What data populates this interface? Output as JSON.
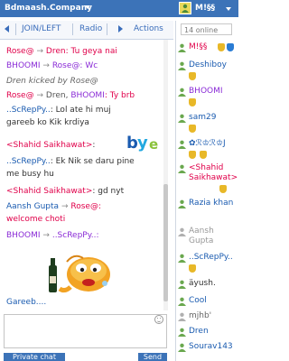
{
  "topbar": {
    "app_title": "Bdmaash.Company",
    "user_name": "M!§§"
  },
  "tabs": {
    "join_left": "JOIN/LEFT",
    "radio": "Radio",
    "actions": "Actions"
  },
  "sidebar": {
    "online": "14 online",
    "users": [
      {
        "name": "M!§§",
        "color": "#e0004a"
      },
      {
        "name": "Deshiboy",
        "color": "#1a5bb0"
      },
      {
        "name": "BHOOMI",
        "color": "#8a2bd6"
      },
      {
        "name": "sam29",
        "color": "#1a5bb0"
      },
      {
        "name": "✿ℛ♔ℛ♔J",
        "color": "#1a5bb0"
      },
      {
        "name": "<Shahid Saikhawat>",
        "color": "#e0004a"
      },
      {
        "name": "Razia khan",
        "color": "#1a5bb0"
      },
      {
        "name": "Aansh Gupta",
        "color": "#999999"
      },
      {
        "name": "..ScRepPy..",
        "color": "#1a5bb0"
      },
      {
        "name": "äyush.",
        "color": "#333333"
      },
      {
        "name": "Cool",
        "color": "#1a5bb0"
      },
      {
        "name": "mjhb'",
        "color": "#666666"
      },
      {
        "name": "Dren",
        "color": "#1a5bb0"
      },
      {
        "name": "Sourav143",
        "color": "#1a5bb0"
      }
    ]
  },
  "messages": {
    "m1": {
      "from": "Rose@",
      "to": "Dren",
      "text": ": Tu geya nai"
    },
    "m2": {
      "from": "BHOOMI",
      "to": "Rose@",
      "text": ": Wc"
    },
    "m3": {
      "text": "Dren kicked by Rose@"
    },
    "m4": {
      "from": "Rose@",
      "to": "Dren,",
      "to2": "BHOOMI",
      "text": ": Ty brb"
    },
    "m5": {
      "from": "..ScRepPy..",
      "text": ": Lol ate hi muj",
      "text2": "gareeb ko Kik krdiya"
    },
    "m6": {
      "from": "<Shahid Saikhawat>",
      "text": ":"
    },
    "m7": {
      "from": "..ScRepPy..",
      "text": ": Ek Nik se daru pine",
      "text2": "me busy hu"
    },
    "m8": {
      "from": "<Shahid Saikhawat>",
      "text": ": gd nyt"
    },
    "m9": {
      "from": "Aansh Gupta",
      "to": "Rose@",
      "text": ":",
      "text2": "welcome choti"
    },
    "m10": {
      "from": "BHOOMI",
      "to": "..ScRepPy..",
      "text": ":"
    },
    "m11": {
      "text": "Gareeb...."
    }
  },
  "bye_sticker": {
    "b": "b",
    "y": "y",
    "e": "e"
  },
  "bottom": {
    "left_button": "Private chat",
    "right_button": "Send"
  },
  "colors": {
    "accent": "#3c73b8",
    "name_red": "#e0004a",
    "name_purple": "#8a2bd6",
    "name_blue": "#1a5bb0"
  }
}
